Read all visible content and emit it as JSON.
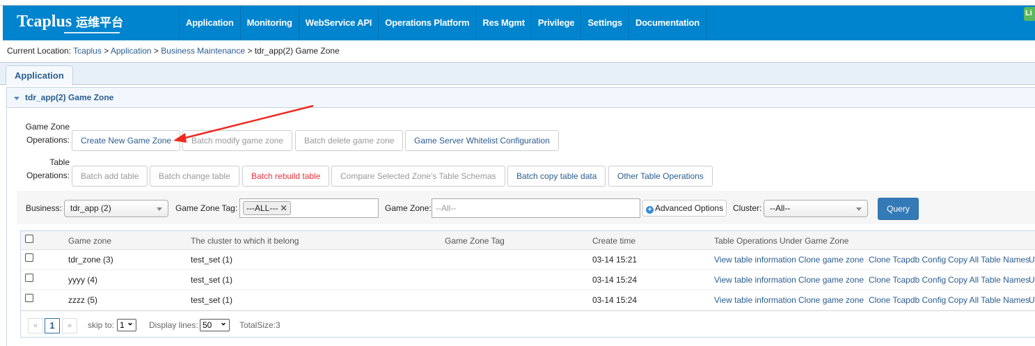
{
  "header": {
    "logo": "Tcaplus",
    "logo_cn": "运维平台",
    "nav": [
      "Application",
      "Monitoring",
      "WebService API",
      "Operations Platform",
      "Res Mgmt",
      "Privilege",
      "Settings",
      "Documentation"
    ],
    "badge": "Li"
  },
  "breadcrumb": {
    "label": "Current Location: ",
    "items": [
      "Tcaplus",
      "Application",
      "Business Maintenance"
    ],
    "current": "tdr_app(2) Game Zone",
    "sep": " > "
  },
  "tab": "Application",
  "panel_title": "tdr_app(2) Game Zone",
  "ops": {
    "game_zone_label1": "Game Zone",
    "game_zone_label2": "Operations:",
    "table_label1": "Table",
    "table_label2": "Operations:",
    "game_zone_buttons": [
      "Create New Game Zone",
      "Batch modify game zone",
      "Batch delete game zone",
      "Game Server Whitelist Configuration"
    ],
    "table_buttons": [
      "Batch add table",
      "Batch change table",
      "Batch rebuild table",
      "Compare Selected Zone's Table Schemas",
      "Batch copy table data",
      "Other Table Operations"
    ]
  },
  "filter": {
    "business_label": "Business:",
    "business_value": "tdr_app (2)",
    "tag_label": "Game Zone Tag:",
    "tag_chip": "---ALL---",
    "zone_label": "Game Zone:",
    "zone_placeholder": "--All--",
    "advanced": "Advanced Options",
    "cluster_label": "Cluster:",
    "cluster_value": "--All--",
    "query": "Query"
  },
  "table": {
    "headers": [
      "Game zone",
      "The cluster to which it belong",
      "Game Zone Tag",
      "Create time",
      "Table Operations Under Game Zone"
    ],
    "rows": [
      {
        "zone": "tdr_zone (3)",
        "cluster": "test_set (1)",
        "tag": "",
        "time": "03-14 15:21"
      },
      {
        "zone": "yyyy (4)",
        "cluster": "test_set (1)",
        "tag": "",
        "time": "03-14 15:24"
      },
      {
        "zone": "zzzz (5)",
        "cluster": "test_set (1)",
        "tag": "",
        "time": "03-14 15:24"
      }
    ],
    "row_links": [
      "View table information",
      "Clone game zone",
      "Clone Tcapdb Config",
      "Copy All Table Names",
      "U"
    ]
  },
  "pager": {
    "prev": "«",
    "page": "1",
    "next": "»",
    "skip_label": "skip to:",
    "skip_value": "1",
    "lines_label": "Display lines:",
    "lines_value": "50",
    "total": "TotalSize:3"
  },
  "colors": {
    "header": "#0084ce",
    "link": "#2a5d8f",
    "danger": "#e8323c",
    "primary": "#337ab7"
  }
}
